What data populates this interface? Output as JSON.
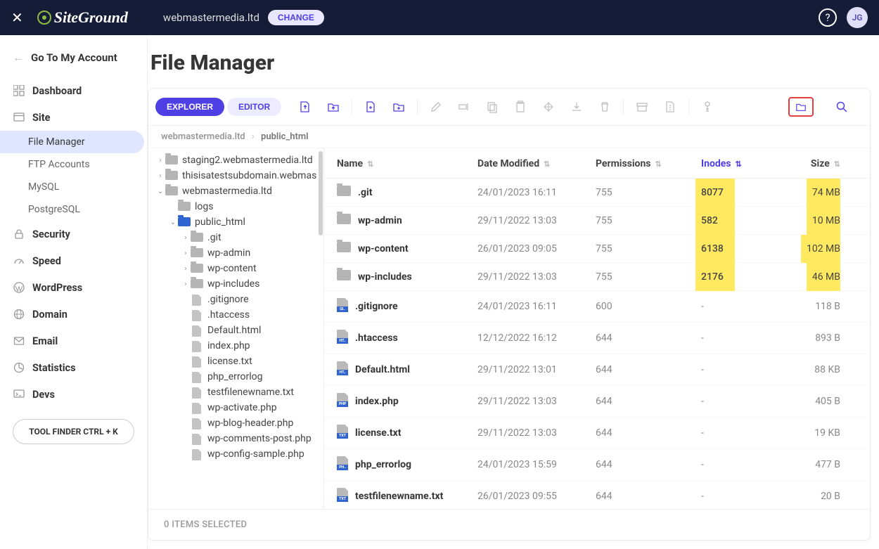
{
  "brand": "SiteGround",
  "topbar": {
    "domain": "webmastermedia.ltd",
    "change_label": "CHANGE",
    "avatar_initials": "JG"
  },
  "back_link": "Go To My Account",
  "sidebar": {
    "items": [
      {
        "label": "Dashboard",
        "children": []
      },
      {
        "label": "Site",
        "children": [
          {
            "label": "File Manager",
            "active": true
          },
          {
            "label": "FTP Accounts"
          },
          {
            "label": "MySQL"
          },
          {
            "label": "PostgreSQL"
          }
        ]
      },
      {
        "label": "Security",
        "children": []
      },
      {
        "label": "Speed",
        "children": []
      },
      {
        "label": "WordPress",
        "children": []
      },
      {
        "label": "Domain",
        "children": []
      },
      {
        "label": "Email",
        "children": []
      },
      {
        "label": "Statistics",
        "children": []
      },
      {
        "label": "Devs",
        "children": []
      }
    ],
    "tool_finder": "TOOL FINDER CTRL + K"
  },
  "page_title": "File Manager",
  "tabs": {
    "explorer": "EXPLORER",
    "editor": "EDITOR"
  },
  "breadcrumb": {
    "root": "webmastermedia.ltd",
    "current": "public_html"
  },
  "tree": [
    {
      "depth": 0,
      "caret": "right",
      "type": "folder",
      "label": "staging2.webmastermedia.ltd"
    },
    {
      "depth": 0,
      "caret": "right",
      "type": "folder",
      "label": "thisisatestsubdomain.webmas"
    },
    {
      "depth": 0,
      "caret": "down",
      "type": "folder",
      "label": "webmastermedia.ltd"
    },
    {
      "depth": 1,
      "caret": "none",
      "type": "folder",
      "label": "logs"
    },
    {
      "depth": 1,
      "caret": "down",
      "type": "folder-open",
      "label": "public_html"
    },
    {
      "depth": 2,
      "caret": "right",
      "type": "folder",
      "label": ".git"
    },
    {
      "depth": 2,
      "caret": "right",
      "type": "folder",
      "label": "wp-admin"
    },
    {
      "depth": 2,
      "caret": "right",
      "type": "folder",
      "label": "wp-content"
    },
    {
      "depth": 2,
      "caret": "right",
      "type": "folder",
      "label": "wp-includes"
    },
    {
      "depth": 2,
      "caret": "none",
      "type": "file",
      "label": ".gitignore"
    },
    {
      "depth": 2,
      "caret": "none",
      "type": "file",
      "label": ".htaccess"
    },
    {
      "depth": 2,
      "caret": "none",
      "type": "file",
      "label": "Default.html"
    },
    {
      "depth": 2,
      "caret": "none",
      "type": "file",
      "label": "index.php"
    },
    {
      "depth": 2,
      "caret": "none",
      "type": "file",
      "label": "license.txt"
    },
    {
      "depth": 2,
      "caret": "none",
      "type": "file",
      "label": "php_errorlog"
    },
    {
      "depth": 2,
      "caret": "none",
      "type": "file",
      "label": "testfilenewname.txt"
    },
    {
      "depth": 2,
      "caret": "none",
      "type": "file",
      "label": "wp-activate.php"
    },
    {
      "depth": 2,
      "caret": "none",
      "type": "file",
      "label": "wp-blog-header.php"
    },
    {
      "depth": 2,
      "caret": "none",
      "type": "file",
      "label": "wp-comments-post.php"
    },
    {
      "depth": 2,
      "caret": "none",
      "type": "file",
      "label": "wp-config-sample.php"
    }
  ],
  "columns": {
    "name": "Name",
    "date": "Date Modified",
    "perm": "Permissions",
    "inodes": "Inodes",
    "size": "Size"
  },
  "rows": [
    {
      "type": "folder",
      "ext": "",
      "name": ".git",
      "date": "24/01/2023 16:11",
      "perm": "755",
      "inodes": "8077",
      "size": "74 MB",
      "hl": true
    },
    {
      "type": "folder",
      "ext": "",
      "name": "wp-admin",
      "date": "29/11/2022 13:03",
      "perm": "755",
      "inodes": "582",
      "size": "10 MB",
      "hl": true
    },
    {
      "type": "folder",
      "ext": "",
      "name": "wp-content",
      "date": "26/01/2023 09:05",
      "perm": "755",
      "inodes": "6138",
      "size": "102 MB",
      "hl": true
    },
    {
      "type": "folder",
      "ext": "",
      "name": "wp-includes",
      "date": "29/11/2022 13:03",
      "perm": "755",
      "inodes": "2176",
      "size": "46 MB",
      "hl": true
    },
    {
      "type": "file",
      "ext": "GI..",
      "name": ".gitignore",
      "date": "24/01/2023 16:11",
      "perm": "600",
      "inodes": "-",
      "size": "118 B",
      "hl": false
    },
    {
      "type": "file",
      "ext": "HT..",
      "name": ".htaccess",
      "date": "12/12/2022 16:12",
      "perm": "644",
      "inodes": "-",
      "size": "893 B",
      "hl": false
    },
    {
      "type": "file",
      "ext": "HT..",
      "name": "Default.html",
      "date": "29/11/2022 13:01",
      "perm": "644",
      "inodes": "-",
      "size": "88 KB",
      "hl": false
    },
    {
      "type": "file",
      "ext": "PHP",
      "name": "index.php",
      "date": "29/11/2022 13:03",
      "perm": "644",
      "inodes": "-",
      "size": "405 B",
      "hl": false
    },
    {
      "type": "file",
      "ext": "TXT",
      "name": "license.txt",
      "date": "29/11/2022 13:03",
      "perm": "644",
      "inodes": "-",
      "size": "19 KB",
      "hl": false
    },
    {
      "type": "file",
      "ext": "PH..",
      "name": "php_errorlog",
      "date": "24/01/2023 15:59",
      "perm": "644",
      "inodes": "-",
      "size": "477 B",
      "hl": false
    },
    {
      "type": "file",
      "ext": "TXT",
      "name": "testfilenewname.txt",
      "date": "26/01/2023 09:55",
      "perm": "644",
      "inodes": "-",
      "size": "20 B",
      "hl": false
    }
  ],
  "footer": "0 ITEMS SELECTED"
}
